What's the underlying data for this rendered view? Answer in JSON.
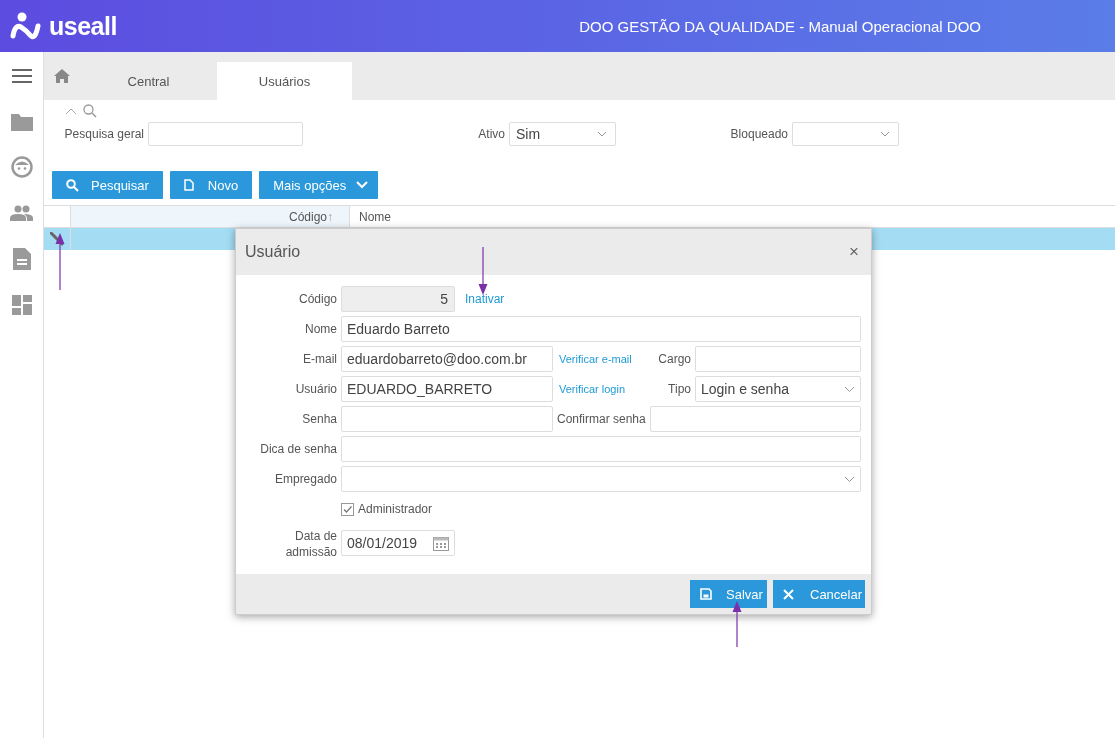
{
  "header": {
    "logo": "useall",
    "title": "DOO GESTÃO DA QUALIDADE - Manual Operacional DOO"
  },
  "tabs": [
    {
      "label": "Central",
      "selected": false
    },
    {
      "label": "Usuários",
      "selected": true
    }
  ],
  "filters": [
    {
      "kind": "text",
      "label": "Pesquisa geral"
    },
    {
      "kind": "select",
      "label": "Ativo",
      "value": "Sim"
    },
    {
      "kind": "select",
      "label": "Bloqueado"
    }
  ],
  "toolbar": [
    {
      "kind": "search",
      "label": "Pesquisar"
    },
    {
      "kind": "new",
      "label": "Novo"
    },
    {
      "kind": "dropdown",
      "label": "Mais opções"
    }
  ],
  "table": {
    "columns": [
      {
        "label": "Código",
        "sort_mark": "↑"
      },
      {
        "label": "Nome"
      }
    ],
    "rows": [
      {
        "selected": true
      }
    ]
  },
  "dialog": {
    "title": "Usuário",
    "close": "×",
    "rows": [
      [
        {
          "kind": "label",
          "text": "Código"
        },
        {
          "kind": "readonly",
          "value": "5"
        },
        {
          "kind": "link",
          "text": "Inativar"
        }
      ],
      [
        {
          "kind": "label",
          "text": "Nome"
        },
        {
          "kind": "input",
          "value": "Eduardo Barreto"
        }
      ],
      [
        {
          "kind": "label",
          "text": "E-mail"
        },
        {
          "kind": "input",
          "value": "eduardobarreto@doo.com.br"
        },
        {
          "kind": "link",
          "text": "Verificar e-mail"
        },
        {
          "kind": "label",
          "text": "Cargo"
        },
        {
          "kind": "input"
        }
      ],
      [
        {
          "kind": "label",
          "text": "Usuário"
        },
        {
          "kind": "input",
          "value": "EDUARDO_BARRETO"
        },
        {
          "kind": "link",
          "text": "Verificar login"
        },
        {
          "kind": "label",
          "text": "Tipo"
        },
        {
          "kind": "select",
          "value": "Login e senha"
        }
      ],
      [
        {
          "kind": "label",
          "text": "Senha"
        },
        {
          "kind": "input"
        },
        {
          "kind": "label",
          "text": "Confirmar senha"
        },
        {
          "kind": "input"
        }
      ],
      [
        {
          "kind": "label",
          "text": "Dica de senha"
        },
        {
          "kind": "input"
        }
      ],
      [
        {
          "kind": "label",
          "text": "Empregado"
        },
        {
          "kind": "select"
        }
      ],
      [
        "",
        {
          "kind": "checkbox",
          "text": "Administrador",
          "checked": true
        }
      ],
      [
        {
          "kind": "label",
          "text": "Data de admissão"
        },
        {
          "kind": "date",
          "value": "08/01/2019"
        }
      ]
    ],
    "buttons": [
      {
        "kind": "save",
        "label": "Salvar"
      },
      {
        "kind": "cancel",
        "label": "Cancelar"
      }
    ]
  }
}
